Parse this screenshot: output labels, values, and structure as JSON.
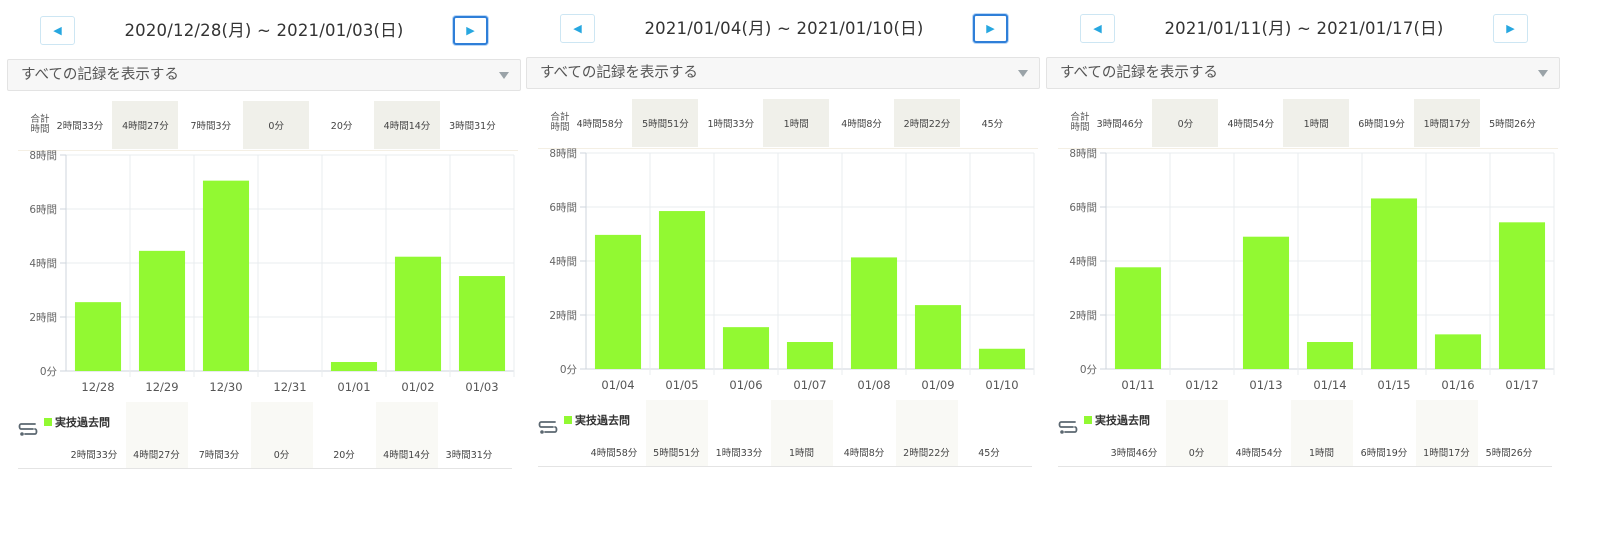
{
  "filter_label": "すべての記録を表示する",
  "total_label": "合計 時間",
  "legend_label": "実技過去問",
  "bar_color": "#92f932",
  "nav_icons": {
    "prev": "caret-left-icon",
    "next": "caret-right-icon"
  },
  "y_ticks": [
    "0分",
    "2時間",
    "4時間",
    "6時間",
    "8時間"
  ],
  "panels": [
    {
      "range": "2020/12/28(月) ~ 2021/01/03(日)",
      "next_active": true,
      "totals": [
        "2時間33分",
        "4時間27分",
        "7時間3分",
        "0分",
        "20分",
        "4時間14分",
        "3時間31分"
      ]
    },
    {
      "range": "2021/01/04(月) ~ 2021/01/10(日)",
      "next_active": true,
      "totals": [
        "4時間58分",
        "5時間51分",
        "1時間33分",
        "1時間",
        "4時間8分",
        "2時間22分",
        "45分"
      ]
    },
    {
      "range": "2021/01/11(月) ~ 2021/01/17(日)",
      "next_active": false,
      "totals": [
        "3時間46分",
        "0分",
        "4時間54分",
        "1時間",
        "6時間19分",
        "1時間17分",
        "5時間26分"
      ]
    }
  ],
  "chart_data": [
    {
      "type": "bar",
      "categories": [
        "12/28",
        "12/29",
        "12/30",
        "12/31",
        "01/01",
        "01/02",
        "01/03"
      ],
      "series": [
        {
          "name": "実技過去問",
          "values": [
            2.55,
            4.45,
            7.05,
            0,
            0.333,
            4.233,
            3.517
          ]
        }
      ],
      "y_tick_labels": [
        "0分",
        "2時間",
        "4時間",
        "6時間",
        "8時間"
      ],
      "ylim": [
        0,
        8
      ],
      "grid": true,
      "legend": "bottom-left"
    },
    {
      "type": "bar",
      "categories": [
        "01/04",
        "01/05",
        "01/06",
        "01/07",
        "01/08",
        "01/09",
        "01/10"
      ],
      "series": [
        {
          "name": "実技過去問",
          "values": [
            4.967,
            5.85,
            1.55,
            1.0,
            4.133,
            2.367,
            0.75
          ]
        }
      ],
      "y_tick_labels": [
        "0分",
        "2時間",
        "4時間",
        "6時間",
        "8時間"
      ],
      "ylim": [
        0,
        8
      ],
      "grid": true,
      "legend": "bottom-left"
    },
    {
      "type": "bar",
      "categories": [
        "01/11",
        "01/12",
        "01/13",
        "01/14",
        "01/15",
        "01/16",
        "01/17"
      ],
      "series": [
        {
          "name": "実技過去問",
          "values": [
            3.767,
            0,
            4.9,
            1.0,
            6.317,
            1.283,
            5.433
          ]
        }
      ],
      "y_tick_labels": [
        "0分",
        "2時間",
        "4時間",
        "6時間",
        "8時間"
      ],
      "ylim": [
        0,
        8
      ],
      "grid": true,
      "legend": "bottom-left"
    }
  ]
}
